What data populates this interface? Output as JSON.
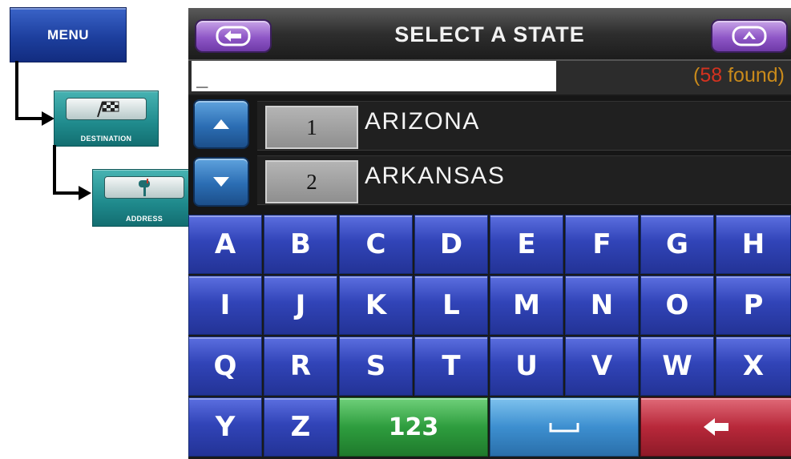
{
  "flow": {
    "menu_label": "MENU",
    "destination_label": "DESTINATION",
    "address_label": "ADDRESS"
  },
  "header": {
    "title": "SELECT A STATE"
  },
  "search": {
    "value": "_",
    "found_open": "(",
    "found_count": "58",
    "found_suffix": " found)"
  },
  "results": [
    {
      "index": "1",
      "name": "ARIZONA"
    },
    {
      "index": "2",
      "name": "ARKANSAS"
    }
  ],
  "keyboard": {
    "rows": [
      [
        "A",
        "B",
        "C",
        "D",
        "E",
        "F",
        "G",
        "H"
      ],
      [
        "I",
        "J",
        "K",
        "L",
        "M",
        "N",
        "O",
        "P"
      ],
      [
        "Q",
        "R",
        "S",
        "T",
        "U",
        "V",
        "W",
        "X"
      ]
    ],
    "last_row_letters": [
      "Y",
      "Z"
    ],
    "numbers_label": "123"
  },
  "colors": {
    "found_text": "#c98a1b",
    "found_count": "#d4321f",
    "key_blue": "#3144b8",
    "key_green": "#2e9d3e",
    "key_cyan": "#3d8fd0",
    "key_red": "#b8283a",
    "header_button": "#8f57c7"
  },
  "icons": {
    "back": "arrow-left-icon",
    "up": "chevron-up-icon",
    "scroll_up": "triangle-up-icon",
    "scroll_down": "triangle-down-icon",
    "space": "space-bar-icon",
    "backspace": "backspace-arrow-icon",
    "destination": "checkered-flag-icon",
    "address": "mailbox-icon"
  }
}
